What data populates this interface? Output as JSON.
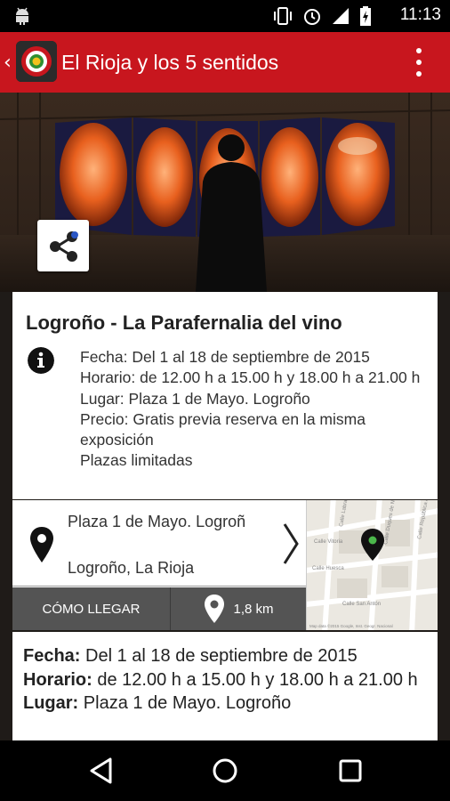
{
  "status_bar": {
    "time": "11:13",
    "icons": [
      "android-icon",
      "vibrate-icon",
      "alarm-icon",
      "signal-icon",
      "battery-icon"
    ]
  },
  "app_bar": {
    "title": "El Rioja y los 5 sentidos",
    "accent_color": "#c8161e"
  },
  "event": {
    "title": "Logroño - La Parafernalia del vino",
    "info_lines": [
      "Fecha: Del 1 al 18 de septiembre de 2015",
      "Horario: de 12.00 h a 15.00 h y 18.00 h a 21.00 h",
      "Lugar: Plaza 1 de Mayo. Logroño",
      "Precio: Gratis previa reserva en la misma exposición",
      "Plazas limitadas"
    ]
  },
  "location": {
    "address_line1": "Plaza 1 de Mayo. Logroñ",
    "address_line2": "Logroño, La Rioja",
    "como_llegar_label": "CÓMO LLEGAR",
    "distance_label": "1,8 km",
    "map_streets": [
      "Calle Huesca",
      "Calle Vitoria",
      "Calle Labradores",
      "Calle San Antón",
      "Calle Duques de Nájera",
      "Calle República Argentina"
    ],
    "map_attribution": "Map data ©2015 Google, Inst. Geogr. Nacional"
  },
  "details": {
    "fecha_label": "Fecha:",
    "fecha_value": "Del 1 al 18 de septiembre de 2015",
    "horario_label": "Horario:",
    "horario_value": "de 12.00 h a 15.00 h y 18.00 h a 21.00 h",
    "lugar_label": "Lugar:",
    "lugar_value": "Plaza 1 de Mayo. Logroño"
  }
}
